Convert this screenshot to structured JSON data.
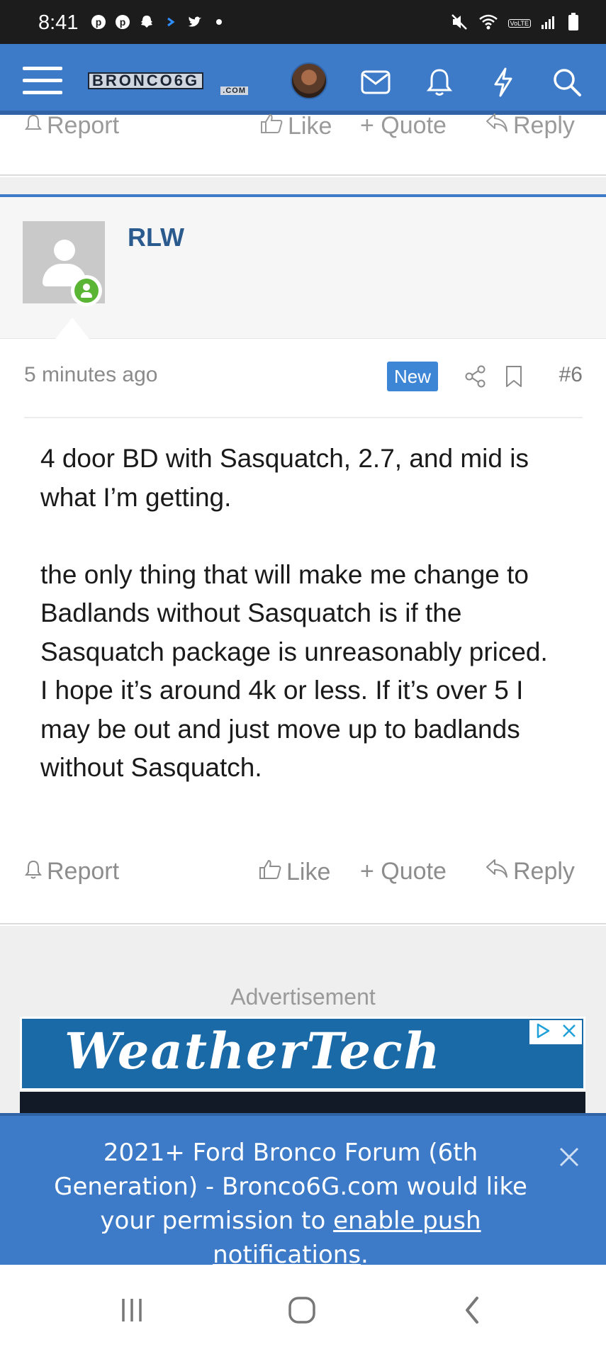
{
  "status_bar": {
    "time": "8:41",
    "volte": "VoLTE"
  },
  "nav": {
    "logo_main": "BRONCO6G",
    "logo_sub": ".COM"
  },
  "prev_post": {
    "report": "Report",
    "like": "Like",
    "quote": "+ Quote",
    "reply": "Reply"
  },
  "post": {
    "username": "RLW",
    "time": "5 minutes ago",
    "badge": "New",
    "number": "#6",
    "body": [
      "4 door BD with Sasquatch, 2.7, and mid is what I’m getting.",
      "",
      "the only thing that will make me change to Badlands without Sasquatch is if the Sasquatch package is unreasonably priced.",
      "I hope it’s around 4k or less. If it’s over 5 I may be out and just move up to badlands without Sasquatch."
    ],
    "actions": {
      "report": "Report",
      "like": "Like",
      "quote": "+ Quote",
      "reply": "Reply"
    }
  },
  "ad": {
    "label": "Advertisement",
    "brand": "WeatherTech"
  },
  "push_banner": {
    "text_before": "2021+ Ford Bronco Forum (6th Generation) - Bronco6G.com would like your permission to ",
    "link": "enable push notifications",
    "text_after": "."
  },
  "colors": {
    "brand_blue": "#3d7bc8",
    "username": "#2b5a8f",
    "new_badge": "#3d86d6",
    "online": "#5bb534"
  }
}
